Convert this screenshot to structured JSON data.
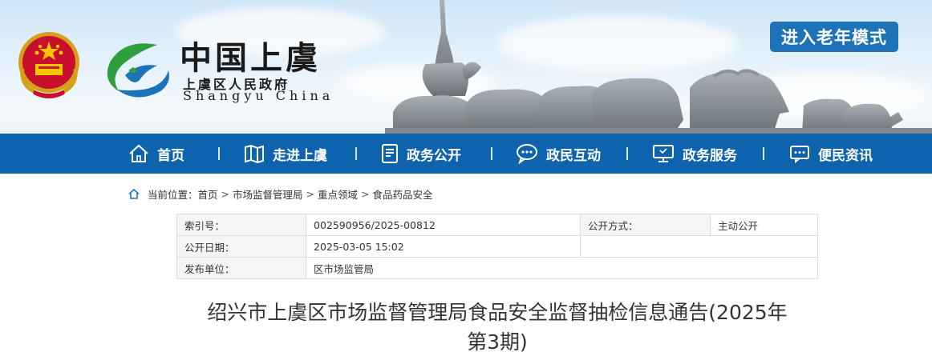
{
  "header": {
    "site_title": "中国上虞",
    "site_subtitle": "上虞区人民政府",
    "site_english": "Shangyu China",
    "elder_mode_label": "进入老年模式"
  },
  "nav": {
    "items": [
      {
        "label": "首页",
        "icon": "home-icon"
      },
      {
        "label": "走进上虞",
        "icon": "map-icon"
      },
      {
        "label": "政务公开",
        "icon": "document-icon"
      },
      {
        "label": "政民互动",
        "icon": "chat-icon"
      },
      {
        "label": "政务服务",
        "icon": "monitor-icon"
      },
      {
        "label": "便民资讯",
        "icon": "message-icon"
      }
    ],
    "accent_color": "#0e63ae"
  },
  "breadcrumb": {
    "prefix": "当前位置：",
    "items": [
      "首页",
      "市场监督管理局",
      "重点领域",
      "食品药品安全"
    ],
    "separator": ">"
  },
  "info": {
    "index_label": "索引号：",
    "index_value": "002590956/2025-00812",
    "method_label": "公开方式：",
    "method_value": "主动公开",
    "date_label": "公开日期：",
    "date_value": "2025-03-05 15:02",
    "unit_label": "发布单位：",
    "unit_value": "区市场监管局"
  },
  "document": {
    "title_line1": "绍兴市上虞区市场监督管理局食品安全监督抽检信息通告(2025年",
    "title_line2": "第3期)"
  }
}
